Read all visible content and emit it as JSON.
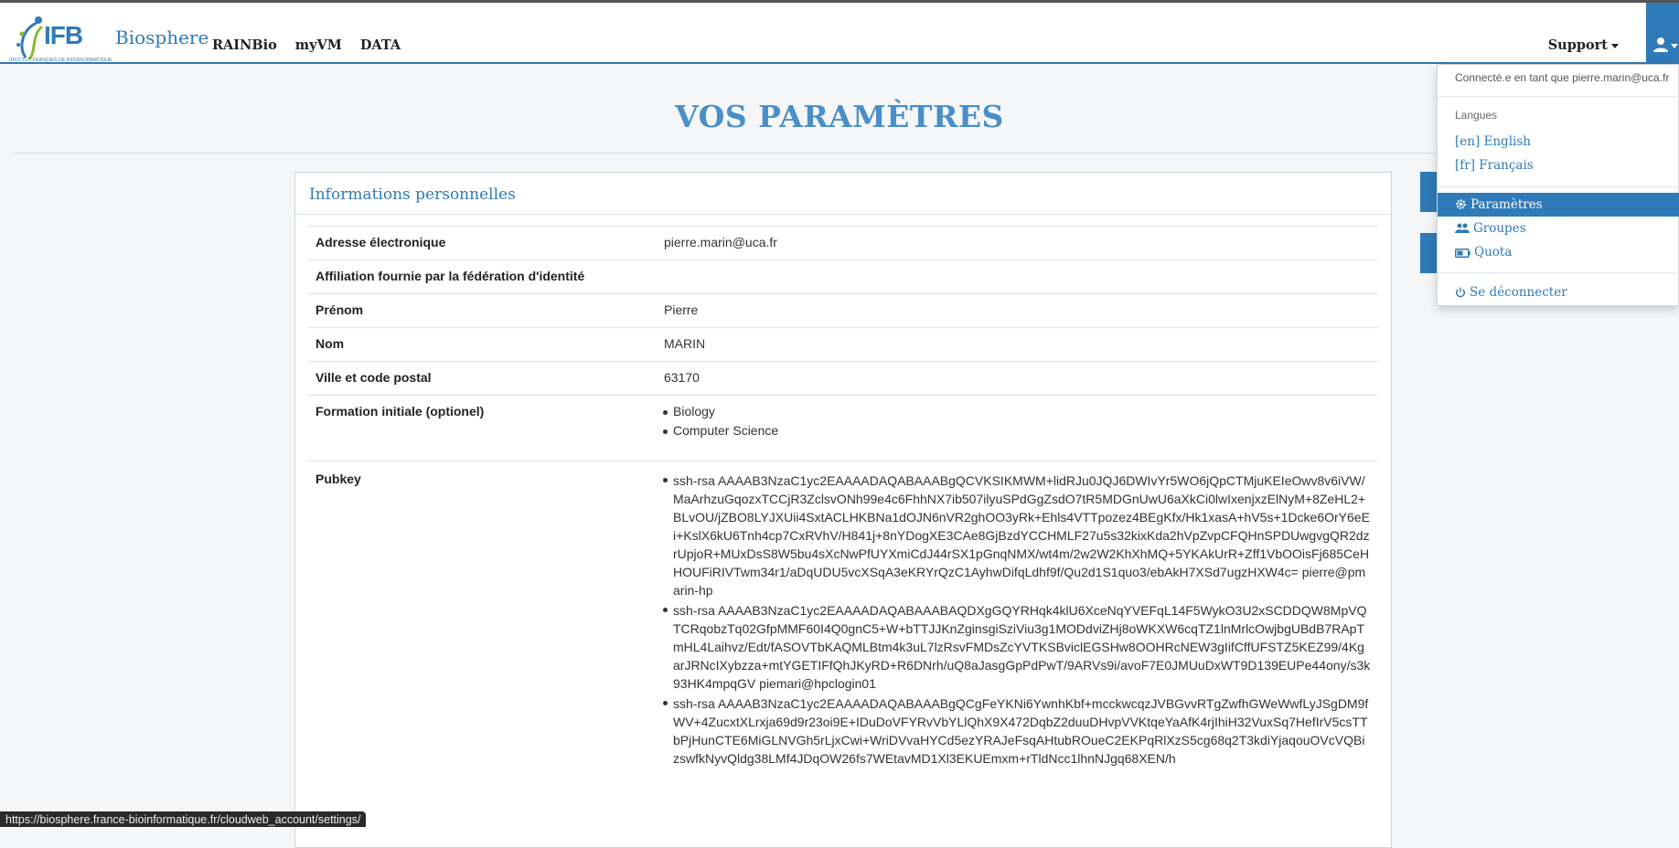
{
  "navbar": {
    "brand_name": "Biosphere",
    "logo_text": "IFB",
    "logo_subtitle": "INSTITUT FRANÇAIS DE BIOINFORMATIQUE",
    "links": [
      "RAINBio",
      "myVM",
      "DATA"
    ],
    "support_label": "Support",
    "user_icon": "user-icon",
    "accent_color": "#2f7ab8"
  },
  "page": {
    "title": "VOS PARAMÈTRES"
  },
  "panel": {
    "heading": "Informations personnelles",
    "rows": [
      {
        "label": "Adresse électronique",
        "value": "pierre.marin@uca.fr"
      },
      {
        "label": "Affiliation fournie par la fédération d'identité",
        "value": ""
      },
      {
        "label": "Prénom",
        "value": "Pierre"
      },
      {
        "label": "Nom",
        "value": "MARIN"
      },
      {
        "label": "Ville et code postal",
        "value": "63170"
      }
    ],
    "formation_label": "Formation initiale (optionel)",
    "formation": [
      "Biology",
      "Computer Science"
    ],
    "pubkey_label": "Pubkey",
    "pubkeys": [
      "ssh-rsa AAAAB3NzaC1yc2EAAAADAQABAAABgQCVKSIKMWM+lidRJu0JQJ6DWIvYr5WO6jQpCTMjuKEIeOwv8v6iVW/MaArhzuGqozxTCCjR3ZclsvONh99e4c6FhhNX7ib507ilyuSPdGgZsdO7tR5MDGnUwU6aXkCi0lwIxenjxzElNyM+8ZeHL2+BLvOU/jZBO8LYJXUii4SxtACLHKBNa1dOJN6nVR2ghOO3yRk+Ehls4VTTpozez4BEgKfx/Hk1xasA+hV5s+1Dcke6OrY6eEi+KslX6kU6Tnh4cp7CxRVhV/H841j+8nYDogXE3CAe8GjBzdYCCHMLF27u5s32kixKda2hVpZvpCFQHnSPDUwgvgQR2dzrUpjoR+MUxDsS8W5bu4sXcNwPfUYXmiCdJ44rSX1pGnqNMX/wt4m/2w2W2KhXhMQ+5YKAkUrR+Zff1VbOOisFj685CeHHOUFiRIVTwm34r1/aDqUDU5vcXSqA3eKRYrQzC1AyhwDifqLdhf9f/Qu2d1S1quo3/ebAkH7XSd7ugzHXW4c= pierre@pmarin-hp",
      "ssh-rsa AAAAB3NzaC1yc2EAAAADAQABAAABAQDXgGQYRHqk4klU6XceNqYVEFqL14F5WykO3U2xSCDDQW8MpVQTCRqobzTq02GfpMMF60I4Q0gnC5+W+bTTJJKnZginsgiSziViu3g1MODdviZHj8oWKXW6cqTZ1lnMrlcOwjbgUBdB7RApTmHL4Laihvz/Edt/fASOVTbKAQMLBtm4k3uL7lzRsvFMDsZcYVTKSBviclEGSHw8OOHRcNEW3gIifCffUFSTZ5KEZ99/4KgarJRNcIXybzza+mtYGETIFfQhJKyRD+R6DNrh/uQ8aJasgGpPdPwT/9ARVs9i/avoF7E0JMUuDxWT9D139EUPe44ony/s3k93HK4mpqGV piemari@hpclogin01",
      "ssh-rsa AAAAB3NzaC1yc2EAAAADAQABAAABgQCgFeYKNi6YwnhKbf+mcckwcqzJVBGvvRTgZwfhGWeWwfLyJSgDM9fWV+4ZucxtXLrxja69d9r23oi9E+IDuDoVFYRvVbYLlQhX9X472DqbZ2duuDHvpVVKtqeYaAfK4rjIhiH32VuxSq7HefIrV5csTTbPjHunCTE6MiGLNVGh5rLjxCwi+WriDVvaHYCd5ezYRAJeFsqAHtubROueC2EKPqRlXzS5cg68q2T3kdiYjaqouOVcVQBizswfkNyvQldg38LMf4JDqOW26fs7WEtavMD1Xl3EKUEmxm+rTldNcc1lhnNJgq68XEN/h"
    ]
  },
  "dropdown": {
    "connected_as": "Connecté.e en tant que pierre.marin@uca.fr",
    "languages_header": "Langues",
    "lang_en": "[en] English",
    "lang_fr": "[fr] Français",
    "settings": "Paramètres",
    "groups": "Groupes",
    "quota": "Quota",
    "logout": "Se déconnecter"
  },
  "status_bar": {
    "url": "https://biosphere.france-bioinformatique.fr/cloudweb_account/settings/"
  }
}
